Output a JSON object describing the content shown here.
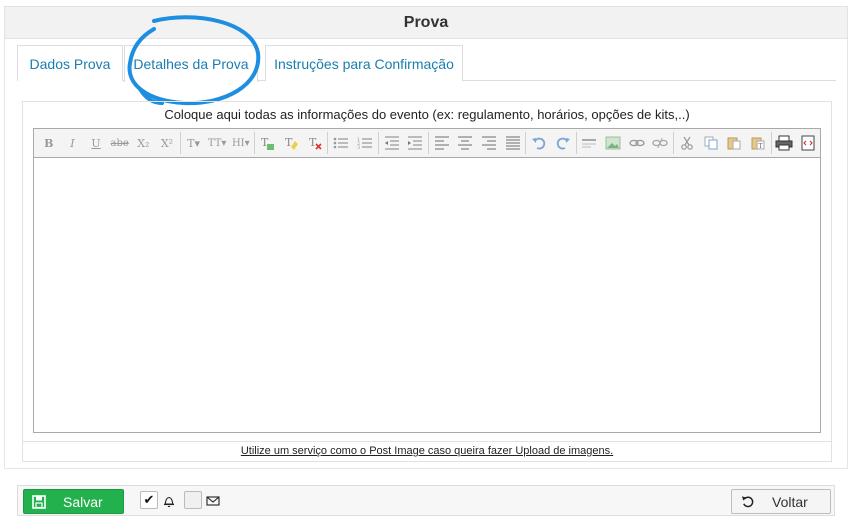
{
  "header": {
    "title": "Prova"
  },
  "tabs": [
    {
      "label": "Dados Prova",
      "active": false
    },
    {
      "label": "Detalhes da Prova",
      "active": true
    },
    {
      "label": "Instruções para Confirmação",
      "active": false
    }
  ],
  "editor": {
    "caption": "Coloque aqui todas as informações do evento (ex: regulamento, horários, opções de kits,..)",
    "content": "",
    "toolbar_buttons": [
      "bold-icon",
      "italic-icon",
      "underline-icon",
      "strikethrough-icon",
      "subscript-icon",
      "superscript-icon",
      "font-family-icon",
      "font-size-icon",
      "heading-icon",
      "text-color-icon",
      "highlight-icon",
      "remove-format-icon",
      "unordered-list-icon",
      "ordered-list-icon",
      "outdent-icon",
      "indent-icon",
      "align-left-icon",
      "align-center-icon",
      "align-right-icon",
      "justify-icon",
      "undo-icon",
      "redo-icon",
      "horizontal-rule-icon",
      "image-icon",
      "link-icon",
      "unlink-icon",
      "cut-icon",
      "copy-icon",
      "paste-icon",
      "paste-text-icon",
      "print-icon",
      "source-code-icon"
    ],
    "toolbar_glyphs": {
      "bold": "B",
      "italic": "I",
      "underline": "U",
      "strike": "abe",
      "subscript": "X₂",
      "superscript": "X²",
      "font": "T▾",
      "size": "TT▾",
      "heading": "HI▾"
    }
  },
  "upload_hint": "Utilize um serviço como o Post Image caso queira fazer Upload de imagens.",
  "footer": {
    "save_label": "Salvar",
    "back_label": "Voltar",
    "notify_bell_checked": true,
    "notify_email_checked": false
  },
  "colors": {
    "tab_text": "#1a7eb0",
    "save_bg": "#22b14c",
    "annotation": "#1e8fe0"
  }
}
